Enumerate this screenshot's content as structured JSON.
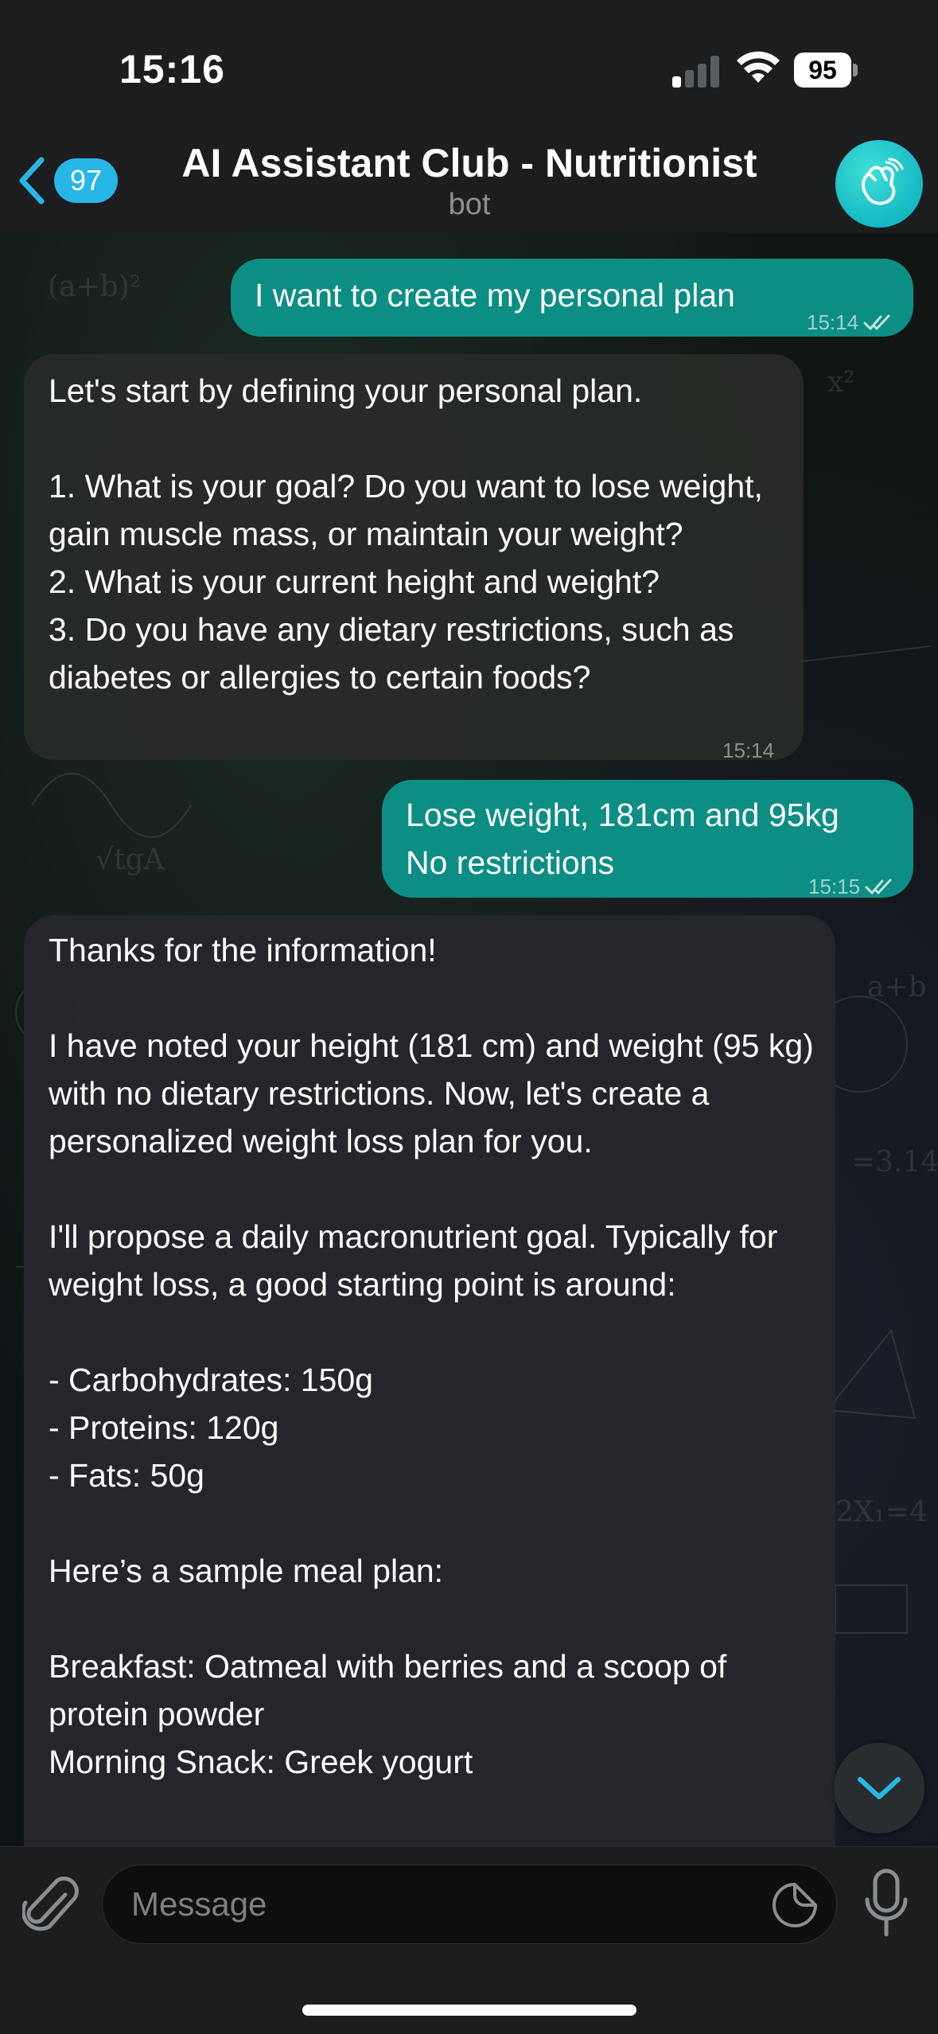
{
  "status_bar": {
    "time": "15:16",
    "battery": "95"
  },
  "header": {
    "back_count": "97",
    "title": "AI Assistant Club - Nutritionist",
    "subtitle": "bot"
  },
  "messages": [
    {
      "direction": "out",
      "text": "I want to create my personal plan",
      "time": "15:14"
    },
    {
      "direction": "in",
      "text": "Let's start by defining your personal plan.\n\n1. What is your goal? Do you want to lose weight, gain muscle mass, or maintain your weight?\n2. What is your current height and weight?\n3. Do you have any dietary restrictions, such as diabetes or allergies to certain foods?",
      "time": "15:14"
    },
    {
      "direction": "out",
      "text": "Lose weight, 181cm and 95kg\nNo restrictions",
      "time": "15:15"
    },
    {
      "direction": "in",
      "text": "Thanks for the information!\n\nI have noted your height (181 cm) and weight (95 kg) with no dietary restrictions. Now, let's create a personalized weight loss plan for you.\n\nI'll propose a daily macronutrient goal. Typically for weight loss, a good starting point is around:\n\n- Carbohydrates: 150g\n- Proteins: 120g\n- Fats: 50g\n\nHere’s a sample meal plan:\n\nBreakfast: Oatmeal with berries and a scoop of protein powder\nMorning Snack: Greek yogurt"
    }
  ],
  "composer": {
    "placeholder": "Message"
  },
  "colors": {
    "accent": "#27b7e6",
    "outgoing_bubble": "#0c8e84",
    "incoming_bubble": "#282b26"
  },
  "icons": [
    "back-chevron-icon",
    "bot-avatar-icon",
    "double-check-icon",
    "scroll-down-chevron-icon",
    "paperclip-icon",
    "sticker-icon",
    "microphone-icon"
  ]
}
